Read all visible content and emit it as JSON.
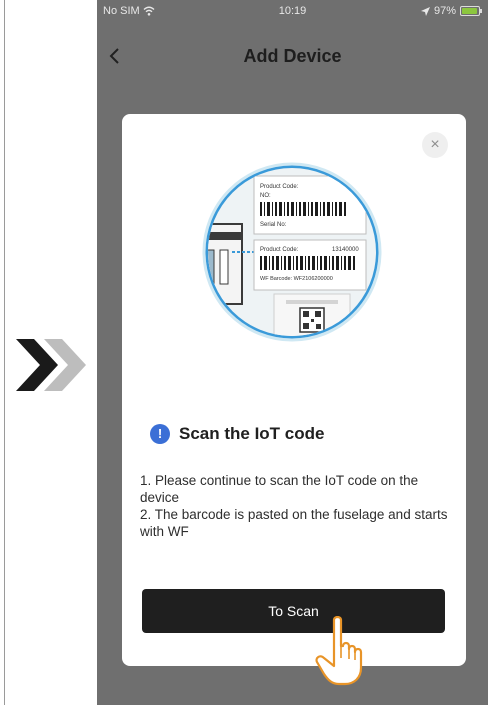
{
  "status_bar": {
    "carrier": "No SIM",
    "time": "10:19",
    "battery": "97%",
    "battery_level": 0.97
  },
  "nav": {
    "back_icon": "chevron-left-icon",
    "title": "Add Device"
  },
  "dialog": {
    "close_icon": "close-icon",
    "illustration": {
      "label_1": "Product Code:",
      "label_2": "NO:",
      "label_3": "Serial No:",
      "label_4": "Product Code:",
      "value_4": "13140000",
      "label_5": "WF Barcode: WF2106200000"
    },
    "heading": "Scan the IoT code",
    "instructions": [
      "1. Please continue to scan the IoT code on the device",
      "2. The barcode is pasted on the fuselage and starts with WF"
    ],
    "scan_button": "To Scan"
  },
  "colors": {
    "overlay": "#6f6f6f",
    "button": "#1f1f1f",
    "info_icon": "#3b6fd6",
    "chevron_dark": "#1a1a1a",
    "chevron_light": "#bdbdbd"
  }
}
